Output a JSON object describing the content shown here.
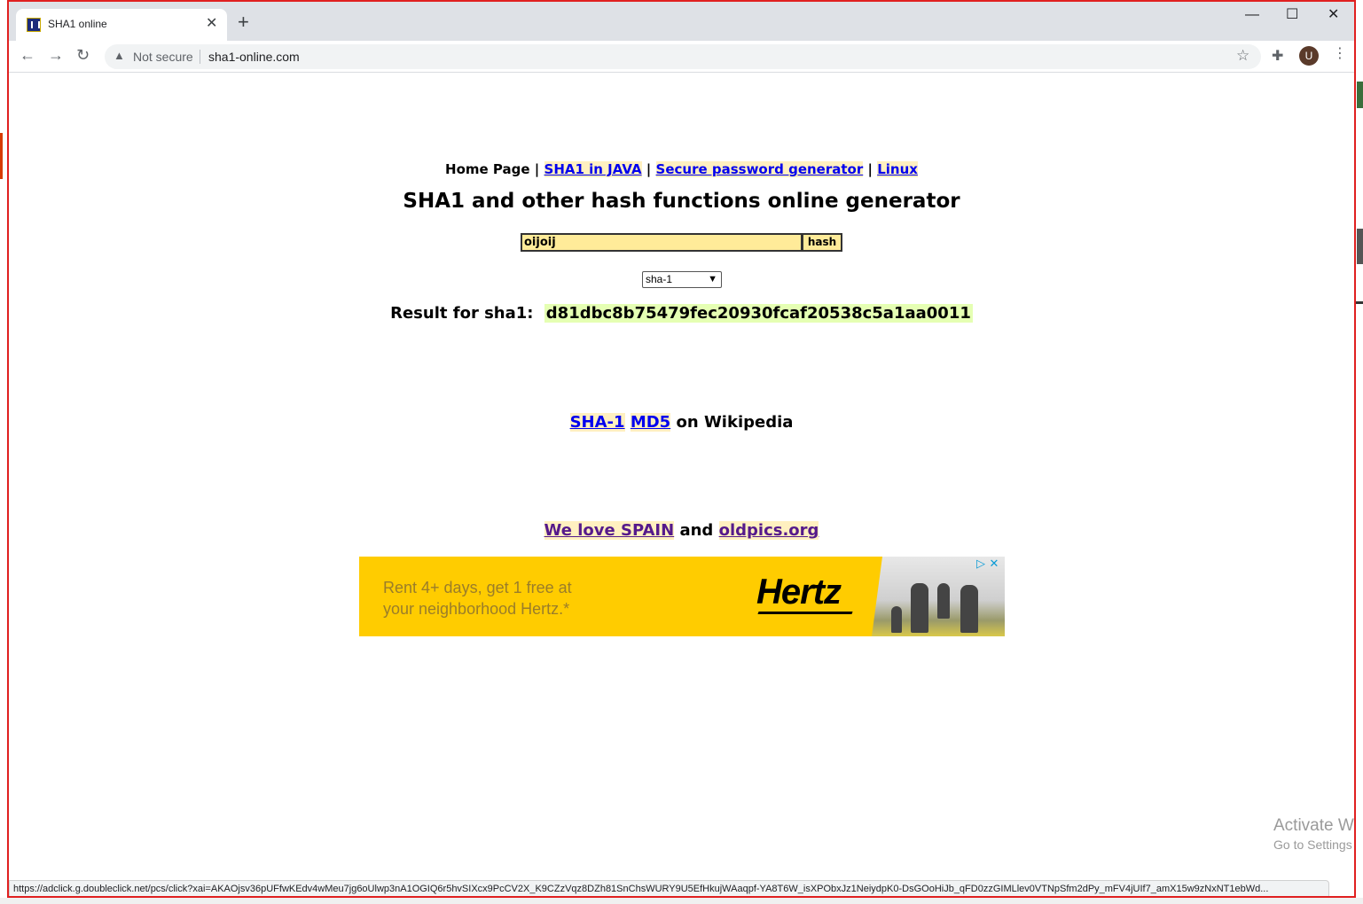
{
  "browser": {
    "tab_title": "SHA1 online",
    "tab_close": "✕",
    "new_tab": "+",
    "window_controls": {
      "minimize": "—",
      "maximize": "☐",
      "close": "✕"
    },
    "nav": {
      "back": "←",
      "forward": "→",
      "reload": "↻"
    },
    "security_label": "Not secure",
    "url": "sha1-online.com",
    "avatar_letter": "U",
    "status_url": "https://adclick.g.doubleclick.net/pcs/click?xai=AKAOjsv36pUFfwKEdv4wMeu7jg6oUlwp3nA1OGIQ6r5hvSIXcx9PcCV2X_K9CZzVqz8DZh81SnChsWURY9U5EfHkujWAaqpf-YA8T6W_isXPObxJz1NeiydpK0-DsGOoHiJb_qFD0zzGIMLlev0VTNpSfm2dPy_mFV4jUIf7_amX15w9zNxNT1ebWd..."
  },
  "page": {
    "nav": {
      "home": "Home Page",
      "sep": "|",
      "sha1_java": "SHA1 in JAVA",
      "password_gen": "Secure password generator",
      "linux": "Linux"
    },
    "title": "SHA1 and other hash functions online generator",
    "form": {
      "input_value": "oijoij",
      "button_label": "hash",
      "algorithm": "sha-1"
    },
    "result": {
      "label": "Result for sha1:",
      "value": "d81dbc8b75479fec20930fcaf20538c5a1aa0011"
    },
    "wiki": {
      "sha1": "SHA-1",
      "md5": "MD5",
      "suffix": "on Wikipedia"
    },
    "love": {
      "spain": "We love SPAIN",
      "and": "and",
      "oldpics": "oldpics.org"
    },
    "ad": {
      "line1": "Rent 4+ days, get 1 free at",
      "line2": "your neighborhood Hertz.*",
      "brand": "Hertz",
      "choices": "▷ ✕"
    }
  },
  "os_watermark": {
    "line1": "Activate Windows",
    "line2": "Go to Settings to activate Windows."
  },
  "colors": {
    "input_bg": "#ffeb99",
    "result_bg": "#e5ffb3",
    "ad_bg": "#ffcc00",
    "link": "#0000ee",
    "visited_link": "#551a8b"
  }
}
